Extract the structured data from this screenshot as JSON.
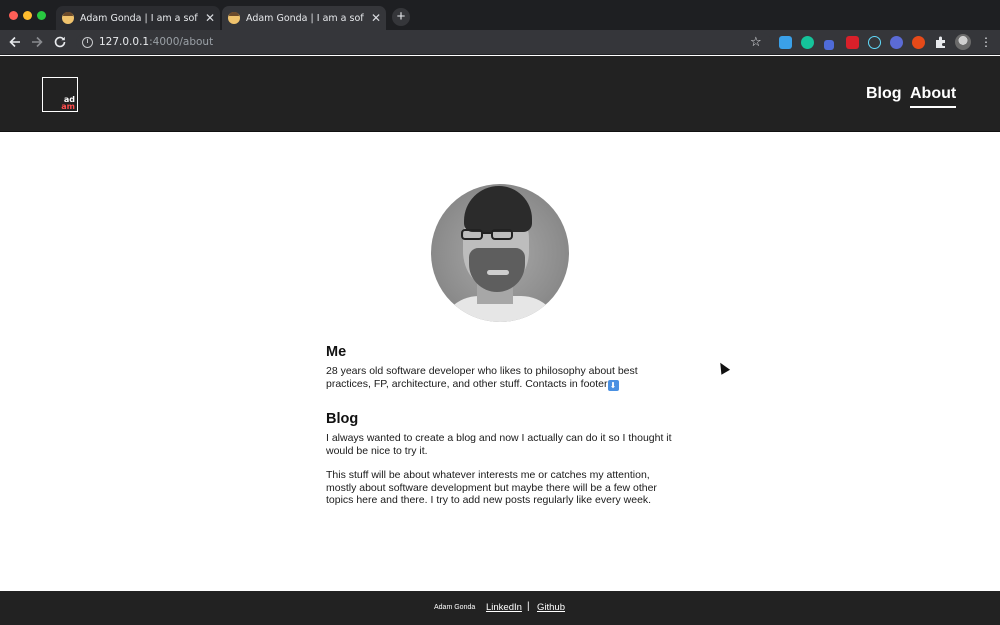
{
  "browser": {
    "tabs": [
      {
        "title": "Adam Gonda | I am a software"
      },
      {
        "title": "Adam Gonda | I am a software"
      }
    ],
    "close_glyph": "✕",
    "new_tab_glyph": "+",
    "url_host": "127.0.0.1",
    "url_path": ":4000/about",
    "icons": [
      "back-arrow-icon",
      "forward-arrow-icon",
      "reload-icon",
      "info-icon",
      "star-icon",
      "extensions-icon",
      "profile-icon",
      "menu-icon"
    ]
  },
  "site": {
    "logo": {
      "line1": "ad",
      "line2": "am"
    },
    "nav": {
      "blog": "Blog",
      "about": "About"
    }
  },
  "about": {
    "me_title": "Me",
    "me_text": "28 years old software developer who likes to philosophy about best practices, FP, architecture, and other stuff. Contacts in footer",
    "me_emoji": "⬇",
    "blog_title": "Blog",
    "blog_text_1": "I always wanted to create a blog and now I actually can do it so I thought it would be nice to try it.",
    "blog_text_2": "This stuff will be about whatever interests me or catches my attention, mostly about software development but maybe there will be a few other topics here and there. I try to add new posts regularly like every week."
  },
  "footer": {
    "name": "Adam Gonda",
    "linkedin": "LinkedIn",
    "separator": "|",
    "github": "Github"
  },
  "colors": {
    "header_bg": "#222222",
    "logo_accent": "#ff4d4d",
    "chrome_bg": "#35363a"
  }
}
